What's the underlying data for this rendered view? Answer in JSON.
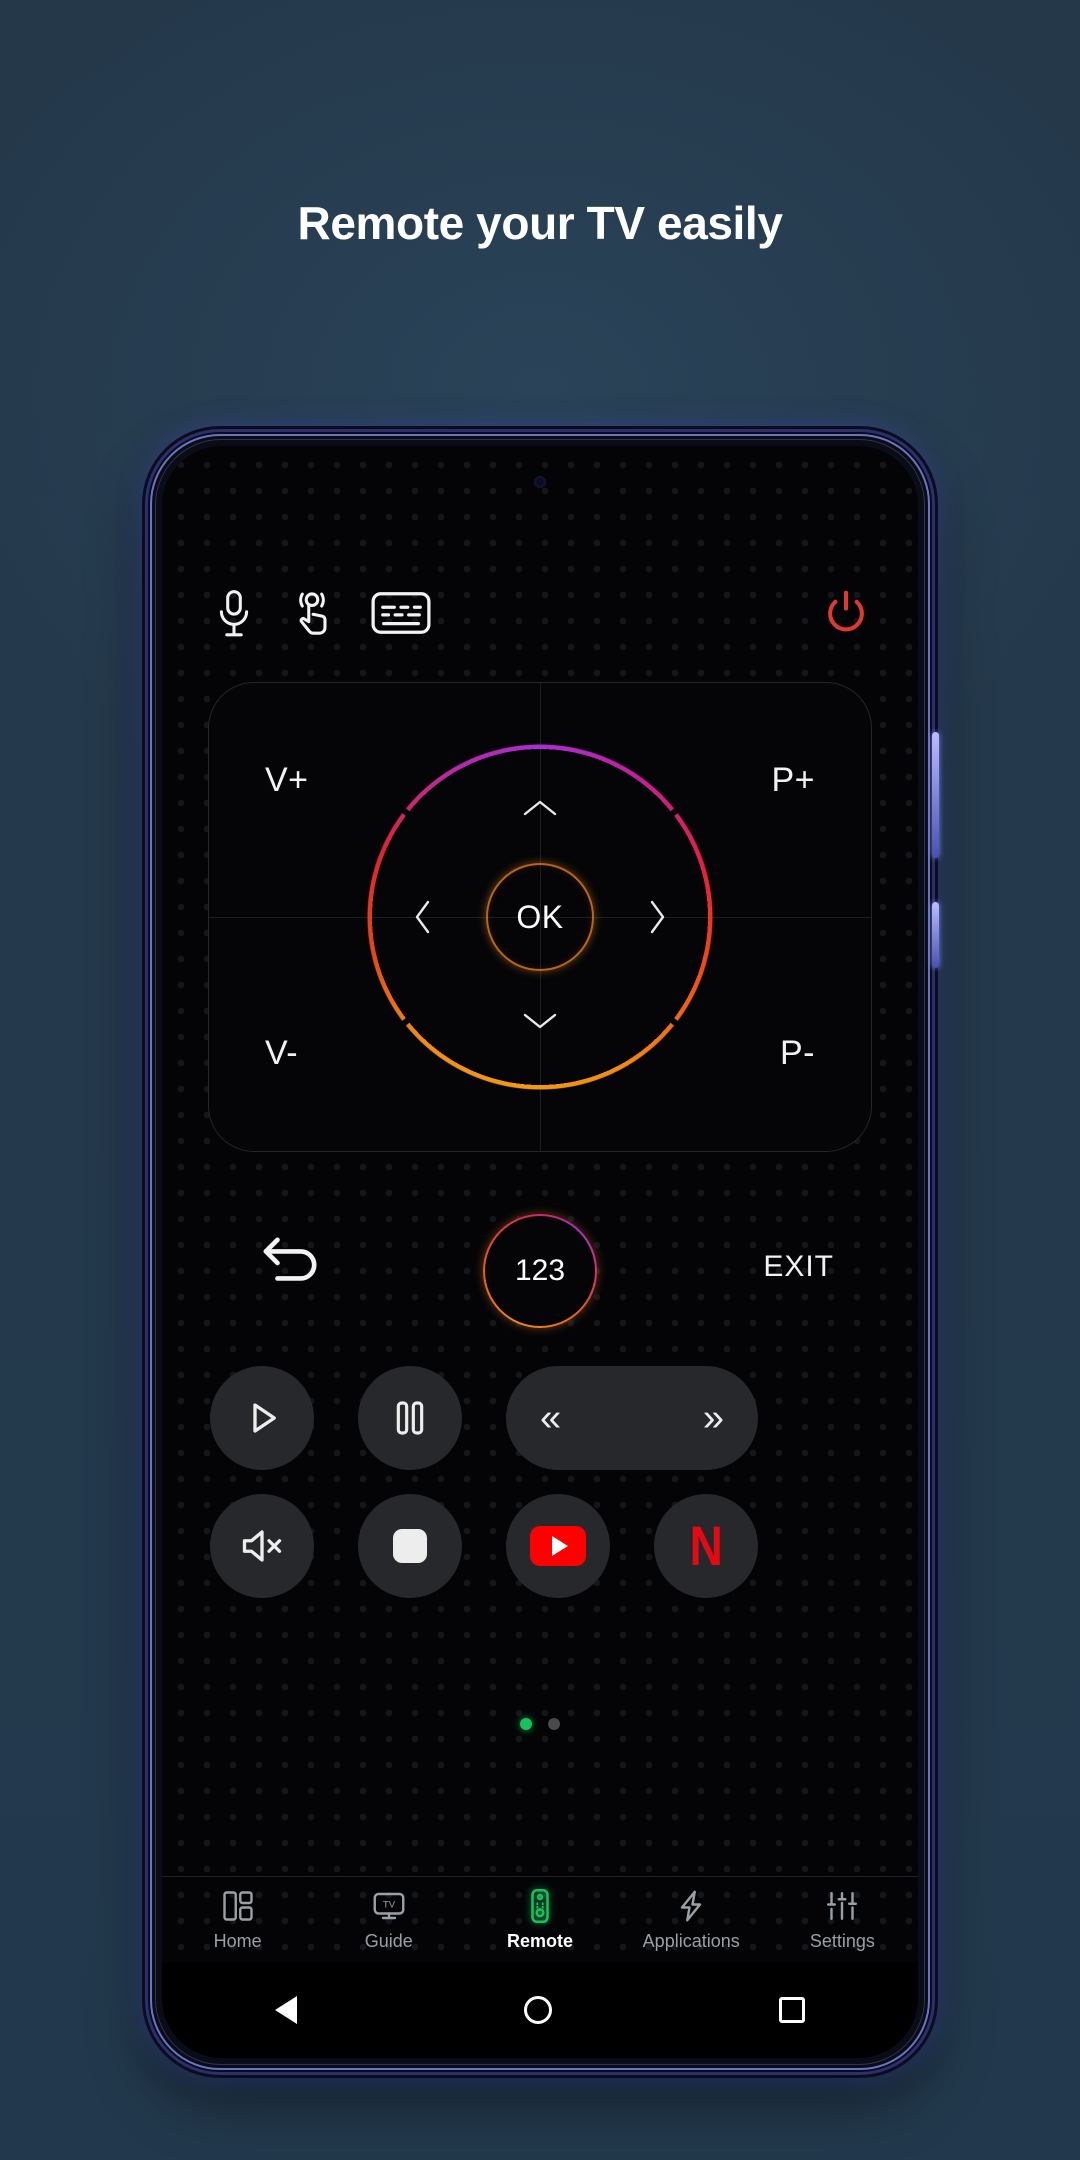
{
  "page": {
    "headline": "Remote your TV easily",
    "background_color": "#243c4f",
    "accent_color": "#f08a12",
    "active_nav_color": "#15c25c"
  },
  "remote": {
    "top_icons": [
      {
        "name": "microphone-icon",
        "label": "Voice"
      },
      {
        "name": "touchpad-icon",
        "label": "Touchpad"
      },
      {
        "name": "keyboard-icon",
        "label": "Keyboard"
      }
    ],
    "power": {
      "name": "power-icon",
      "label": "Power",
      "color": "#e03a2f"
    },
    "dpad": {
      "top_left": "V+",
      "top_right": "P+",
      "bottom_left": "V-",
      "bottom_right": "P-",
      "center": "OK",
      "up": "chevron-up",
      "down": "chevron-down",
      "left": "chevron-left",
      "right": "chevron-right"
    },
    "mid_row": {
      "back_label": "Back",
      "numbers_label": "123",
      "exit_label": "EXIT"
    },
    "media_row_1": [
      {
        "name": "play-button",
        "label": "Play"
      },
      {
        "name": "pause-button",
        "label": "Pause"
      },
      {
        "name": "rewind-button",
        "label": "«"
      },
      {
        "name": "fast-forward-button",
        "label": "»"
      }
    ],
    "media_row_2": [
      {
        "name": "mute-button",
        "label": "Mute"
      },
      {
        "name": "stop-button",
        "label": "Stop"
      },
      {
        "name": "youtube-button",
        "label": "YouTube"
      },
      {
        "name": "netflix-button",
        "label": "N"
      }
    ],
    "pager": {
      "total": 2,
      "active_index": 0
    }
  },
  "bottom_nav": {
    "items": [
      {
        "label": "Home",
        "icon": "dashboard-icon",
        "active": false
      },
      {
        "label": "Guide",
        "icon": "tv-icon",
        "active": false
      },
      {
        "label": "Remote",
        "icon": "remote-icon",
        "active": true
      },
      {
        "label": "Applications",
        "icon": "lightning-icon",
        "active": false
      },
      {
        "label": "Settings",
        "icon": "sliders-icon",
        "active": false
      }
    ]
  },
  "android_nav": {
    "back": "back-button",
    "home": "home-button",
    "recents": "recents-button"
  }
}
